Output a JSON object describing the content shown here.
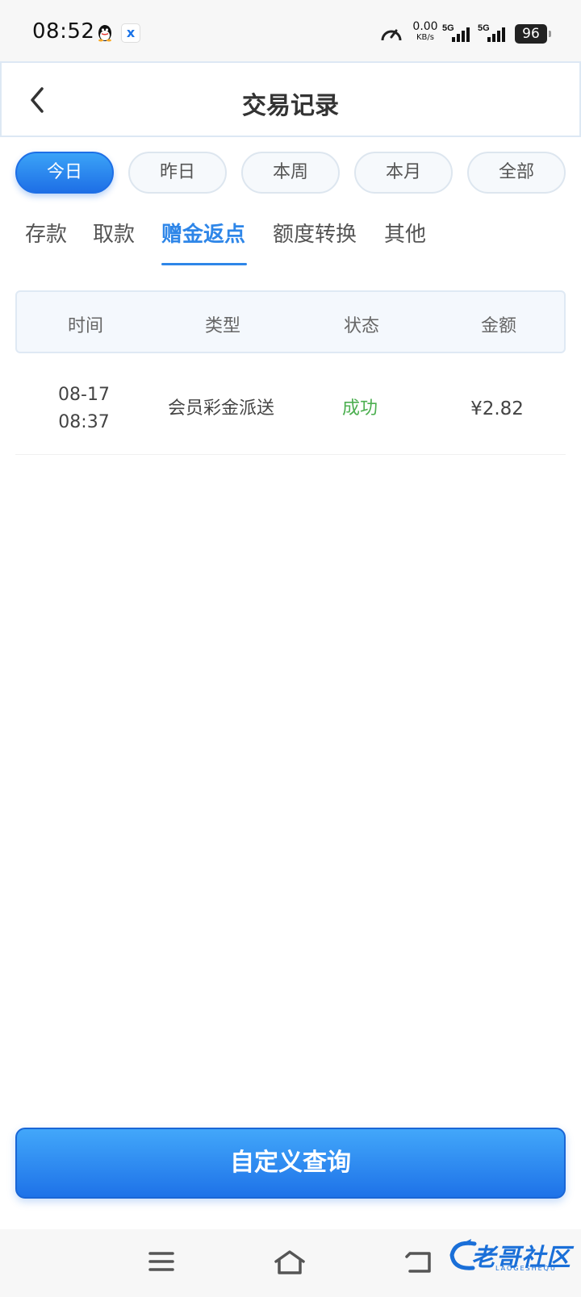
{
  "status_bar": {
    "time": "08:52",
    "net_speed_value": "0.00",
    "net_speed_unit": "KB/s",
    "sig1_label": "5G",
    "sig2_label": "5G",
    "battery": "96"
  },
  "header": {
    "title": "交易记录"
  },
  "filters": {
    "items": [
      {
        "label": "今日",
        "active": true
      },
      {
        "label": "昨日",
        "active": false
      },
      {
        "label": "本周",
        "active": false
      },
      {
        "label": "本月",
        "active": false
      },
      {
        "label": "全部",
        "active": false
      }
    ]
  },
  "categories": {
    "items": [
      {
        "label": "存款",
        "active": false
      },
      {
        "label": "取款",
        "active": false
      },
      {
        "label": "赠金返点",
        "active": true
      },
      {
        "label": "额度转换",
        "active": false
      },
      {
        "label": "其他",
        "active": false
      }
    ]
  },
  "table": {
    "columns": [
      "时间",
      "类型",
      "状态",
      "金额"
    ],
    "rows": [
      {
        "date": "08-17",
        "time": "08:37",
        "type": "会员彩金派送",
        "status": "成功",
        "amount": "¥2.82"
      }
    ]
  },
  "query_button": {
    "label": "自定义查询"
  },
  "watermark": {
    "text": "老哥社区",
    "sub": "LAOGESHEQU"
  },
  "colors": {
    "accent": "#2e86e8",
    "success": "#4caf50",
    "button_gradient_top": "#42a7fa",
    "button_gradient_bottom": "#1e72e8"
  },
  "icons": {
    "back": "chevron-left-icon",
    "menu": "menu-icon",
    "home": "home-icon",
    "nav_back": "back-icon"
  }
}
